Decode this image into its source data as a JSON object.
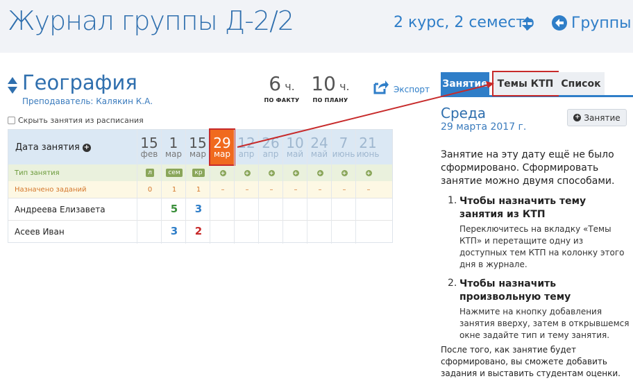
{
  "header": {
    "title": "Журнал группы Д-2/2",
    "course_label": "2 курс, 2 семестр",
    "groups_link": "Группы"
  },
  "subject": {
    "name": "География",
    "teacher": "Преподаватель: Калякин К.А.",
    "hours_fact": {
      "value": "6",
      "unit": "ч.",
      "label": "ПО ФАКТУ"
    },
    "hours_plan": {
      "value": "10",
      "unit": "ч.",
      "label": "ПО ПЛАНУ"
    },
    "export_label": "Экспорт",
    "hide_label": "Скрыть занятия из расписания"
  },
  "journal": {
    "date_header": "Дата занятия",
    "type_row_label": "Тип занятия",
    "assign_row_label": "Назначено заданий",
    "dates": [
      {
        "day": "15",
        "month": "фев"
      },
      {
        "day": "1",
        "month": "мар"
      },
      {
        "day": "15",
        "month": "мар"
      },
      {
        "day": "29",
        "month": "мар"
      },
      {
        "day": "12",
        "month": "апр"
      },
      {
        "day": "26",
        "month": "апр"
      },
      {
        "day": "10",
        "month": "май"
      },
      {
        "day": "24",
        "month": "май"
      },
      {
        "day": "7",
        "month": "июнь"
      },
      {
        "day": "21",
        "month": "июнь"
      }
    ],
    "types": [
      "л",
      "сем",
      "кр",
      "+",
      "+",
      "+",
      "+",
      "+",
      "+",
      "+"
    ],
    "assignments": [
      "0",
      "1",
      "1",
      "–",
      "–",
      "–",
      "–",
      "–",
      "–",
      "–"
    ],
    "students": [
      {
        "name": "Андреева Елизавета",
        "grades": [
          "",
          "5",
          "3",
          "",
          "",
          "",
          "",
          "",
          "",
          ""
        ]
      },
      {
        "name": "Асеев Иван",
        "grades": [
          "",
          "3",
          "2",
          "",
          "",
          "",
          "",
          "",
          "",
          ""
        ]
      }
    ]
  },
  "sidebar": {
    "tabs": [
      "Занятие",
      "Темы КТП",
      "Список"
    ],
    "weekday": "Среда",
    "date": "29 марта 2017 г.",
    "add_button": "Занятие",
    "info": "Занятие на эту дату ещё не было сформировано. Сформировать занятие можно двумя способами.",
    "steps": [
      {
        "num": "1.",
        "title": "Чтобы назначить тему занятия из КТП",
        "text": "Переключитесь на вкладку «Темы КТП» и перетащите одну из доступных тем КТП на колонку этого дня в журнале."
      },
      {
        "num": "2.",
        "title": "Чтобы назначить произвольную тему",
        "text": "Нажмите на кнопку добавления занятия вверху, затем в открывшемся окне задайте тип и тему занятия."
      }
    ],
    "footer": "После того, как занятие будет сформировано, вы сможете добавить задания и выставить студентам оценки."
  },
  "colors": {
    "accent": "#2f7ec8",
    "selected_date": "#f06a1e",
    "callout": "#c72a2a",
    "grade_5": "#3a8f3a",
    "grade_3": "#2f7ec8",
    "grade_2": "#c72a2a"
  }
}
